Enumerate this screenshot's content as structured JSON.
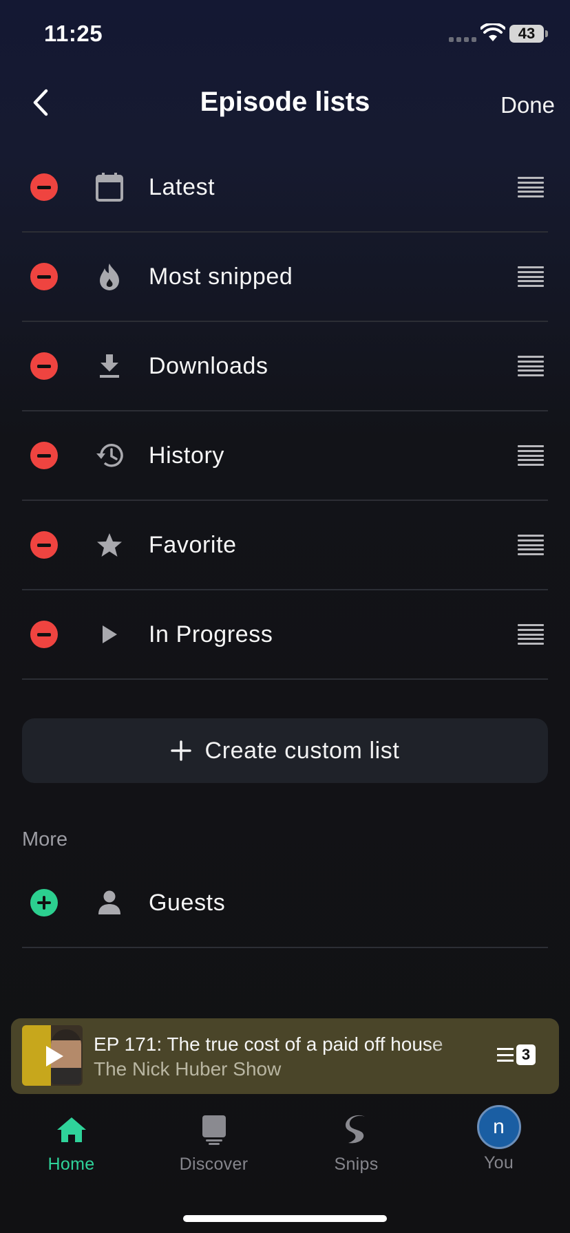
{
  "status_bar": {
    "time": "11:25",
    "battery": "43"
  },
  "header": {
    "back_icon": "chevron-left-icon",
    "title": "Episode lists",
    "done_label": "Done"
  },
  "episode_lists": [
    {
      "label": "Latest",
      "icon": "calendar-icon"
    },
    {
      "label": "Most snipped",
      "icon": "flame-icon"
    },
    {
      "label": "Downloads",
      "icon": "download-icon"
    },
    {
      "label": "History",
      "icon": "history-icon"
    },
    {
      "label": "Favorite",
      "icon": "star-icon"
    },
    {
      "label": "In Progress",
      "icon": "play-icon"
    }
  ],
  "create_list": {
    "label": "Create custom list",
    "icon": "plus-icon"
  },
  "more": {
    "heading": "More",
    "items": [
      {
        "label": "Guests",
        "icon": "person-icon"
      }
    ]
  },
  "player": {
    "title": "EP 171: The true cost of a paid off house",
    "show": "The Nick Huber Show",
    "queue_count": "3"
  },
  "tabs": [
    {
      "label": "Home",
      "icon": "home-icon",
      "active": true
    },
    {
      "label": "Discover",
      "icon": "discover-icon",
      "active": false
    },
    {
      "label": "Snips",
      "icon": "snips-icon",
      "active": false
    },
    {
      "label": "You",
      "avatar_letter": "n",
      "active": false
    }
  ],
  "colors": {
    "remove": "#ef4440",
    "add": "#2ccf8f",
    "active_tab": "#2fd39a",
    "player_bg": "#4a4529"
  }
}
